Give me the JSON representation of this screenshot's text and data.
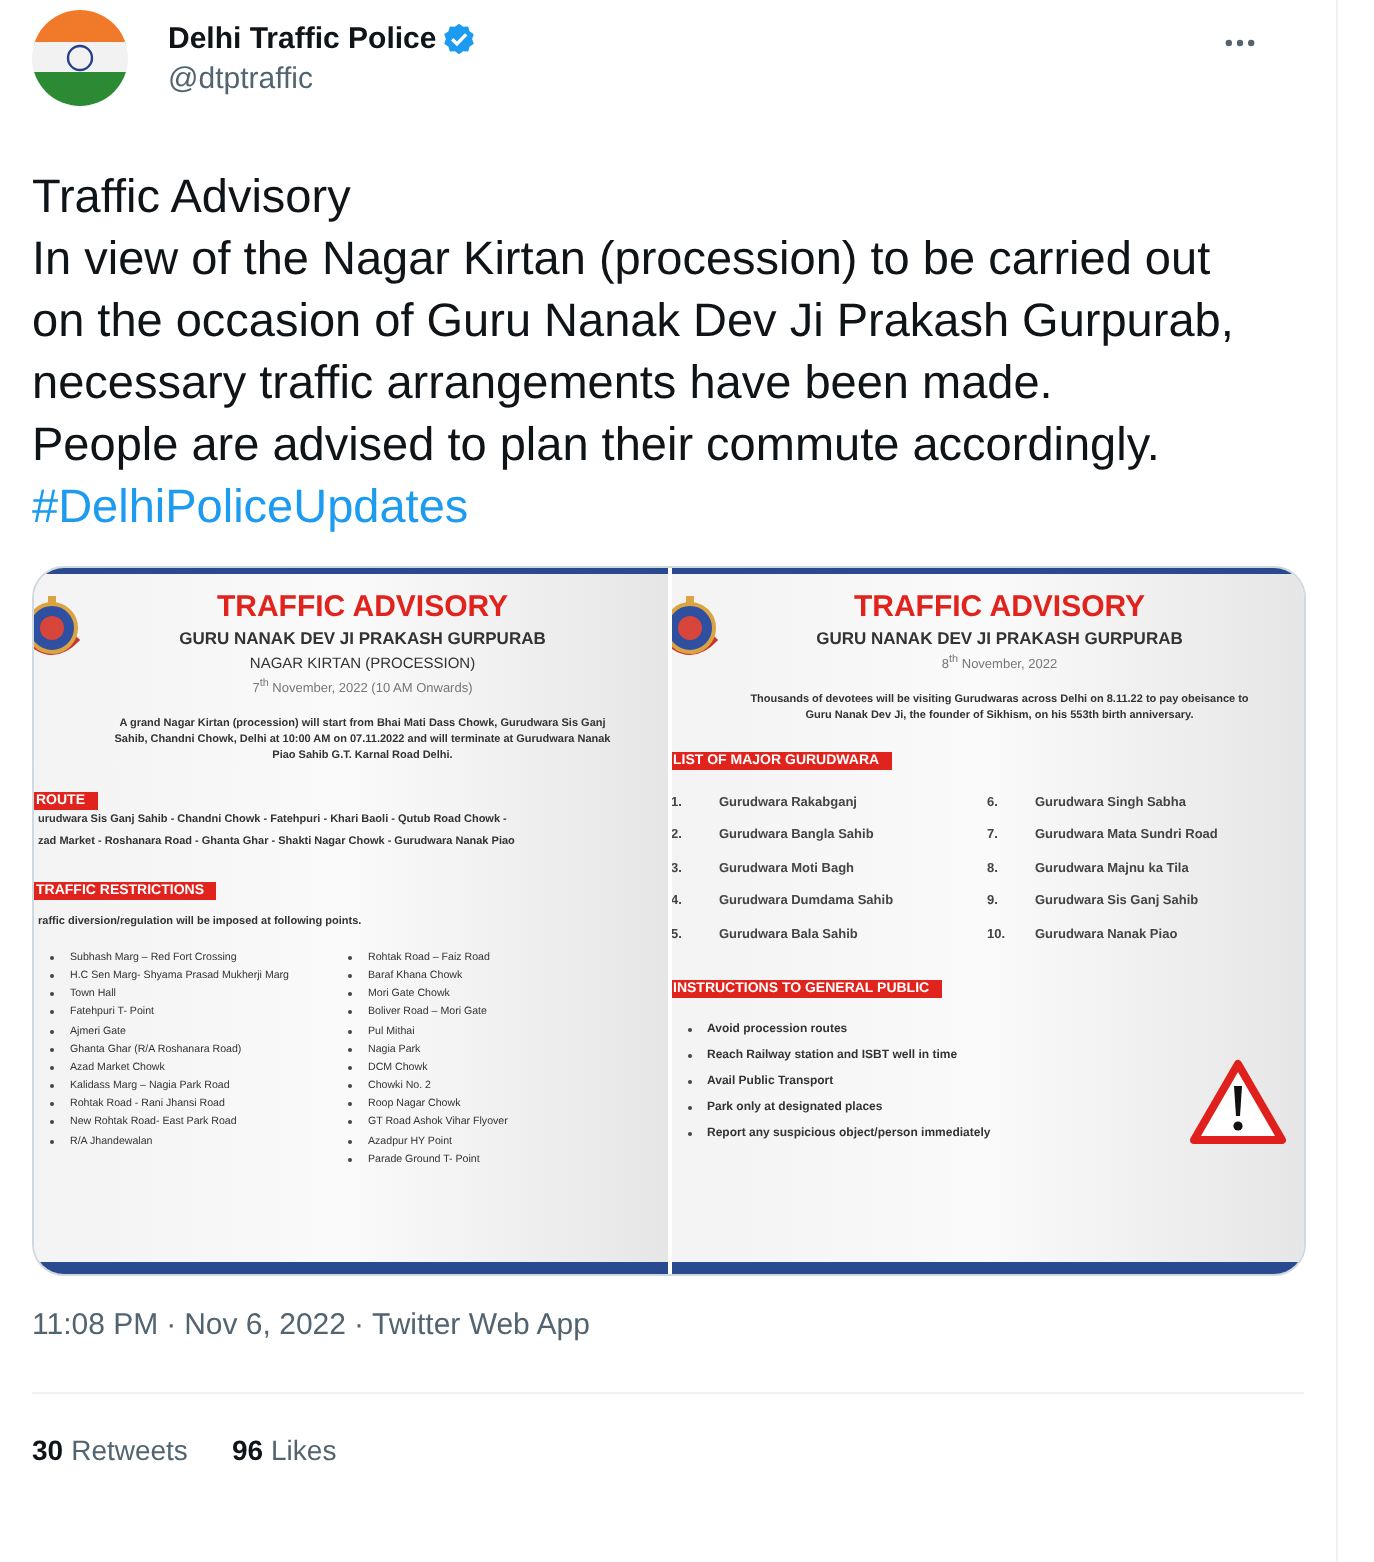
{
  "author": {
    "name": "Delhi Traffic Police",
    "verified": true,
    "handle": "@dtptraffic"
  },
  "tweet": {
    "title": "Traffic Advisory",
    "body": "In view of the Nagar Kirtan (procession) to be carried out on the occasion of Guru Nanak Dev Ji Prakash Gurpurab, necessary traffic arrangements have been made.",
    "advice": "People are advised to plan their commute accordingly.",
    "hashtag": "#DelhiPoliceUpdates"
  },
  "posters": [
    {
      "title": "TRAFFIC ADVISORY",
      "subtitle": "GURU NANAK DEV JI PRAKASH GURPURAB",
      "event": "NAGAR KIRTAN (PROCESSION)",
      "date": "7$^{th}$ November, 2022 (10 AM Onwards)",
      "description": "A grand Nagar Kirtan (procession) will start from Bhai Mati Dass Chowk, Gurudwara Sis Ganj Sahib, Chandni Chowk, Delhi at 10:00 AM on 07.11.2022 and will terminate at Gurudwara Nanak Piao Sahib G.T. Karnal Road Delhi.",
      "sections": [
        {
          "kind": "text",
          "heading": "ROUTE",
          "lines": [
            "urudwara Sis Ganj Sahib - Chandni Chowk - Fatehpuri - Khari Baoli - Qutub Road Chowk -",
            "zad Market - Roshanara Road - Ghanta Ghar - Shakti Nagar Chowk - Gurudwara Nanak Piao"
          ]
        },
        {
          "kind": "bullets",
          "heading": "TRAFFIC RESTRICTIONS",
          "intro": "raffic diversion/regulation will be imposed at following points.",
          "columns": [
            [
              "Subhash Marg – Red Fort Crossing",
              "H.C Sen Marg- Shyama Prasad Mukherji Marg",
              "Town Hall",
              "Fatehpuri T- Point",
              "Ajmeri Gate",
              "Ghanta Ghar (R/A Roshanara Road)",
              "Azad Market Chowk",
              "Kalidass  Marg – Nagia Park Road",
              "Rohtak Road - Rani Jhansi Road",
              "New Rohtak Road- East Park Road",
              "R/A Jhandewalan"
            ],
            [
              "Rohtak Road – Faiz Road",
              "Baraf Khana Chowk",
              "Mori Gate Chowk",
              "Boliver Road – Mori Gate",
              "Pul Mithai",
              "Nagia Park",
              "DCM Chowk",
              "Chowki No. 2",
              "Roop Nagar Chowk",
              "GT Road Ashok Vihar Flyover",
              "Azadpur HY Point",
              "Parade Ground T- Point"
            ]
          ]
        }
      ],
      "warning": false
    },
    {
      "title": "TRAFFIC ADVISORY",
      "subtitle": "GURU NANAK DEV JI PRAKASH GURPURAB",
      "date": "8$^{th}$ November, 2022",
      "description": "Thousands of devotees will be visiting Gurudwaras across Delhi on 8.11.22 to pay obeisance to Guru Nanak Dev Ji, the founder of Sikhism, on his 553th birth anniversary.",
      "sections": [
        {
          "kind": "numbered",
          "heading": "LIST OF MAJOR GURUDWARA",
          "columns": [
            [
              {
                "number": "1.",
                "name": "Gurudwara Rakabganj"
              },
              {
                "number": "2.",
                "name": "Gurudwara Bangla Sahib"
              },
              {
                "number": "3.",
                "name": "Gurudwara Moti Bagh"
              },
              {
                "number": "4.",
                "name": "Gurudwara Dumdama Sahib"
              },
              {
                "number": "5.",
                "name": "Gurudwara Bala Sahib"
              }
            ],
            [
              {
                "number": "6.",
                "name": "Gurudwara Singh Sabha"
              },
              {
                "number": "7.",
                "name": "Gurudwara Mata Sundri Road"
              },
              {
                "number": "8.",
                "name": "Gurudwara Majnu ka Tila"
              },
              {
                "number": "9.",
                "name": "Gurudwara Sis Ganj Sahib"
              },
              {
                "number": "10.",
                "name": "Gurudwara Nanak Piao"
              }
            ]
          ]
        },
        {
          "kind": "bullets",
          "heading": "INSTRUCTIONS TO GENERAL PUBLIC",
          "columns": [
            [
              "Avoid procession routes",
              "Reach Railway station and ISBT well in time",
              "Avail Public Transport",
              "Park only at designated places",
              "Report any suspicious object/person immediately"
            ]
          ]
        }
      ],
      "warning": true
    }
  ],
  "meta": {
    "time": "11:08 PM",
    "date": "Nov 6, 2022",
    "source": "Twitter Web App",
    "separator": "·"
  },
  "stats": [
    {
      "count": "30",
      "label": "Retweets"
    },
    {
      "count": "96",
      "label": "Likes"
    }
  ]
}
